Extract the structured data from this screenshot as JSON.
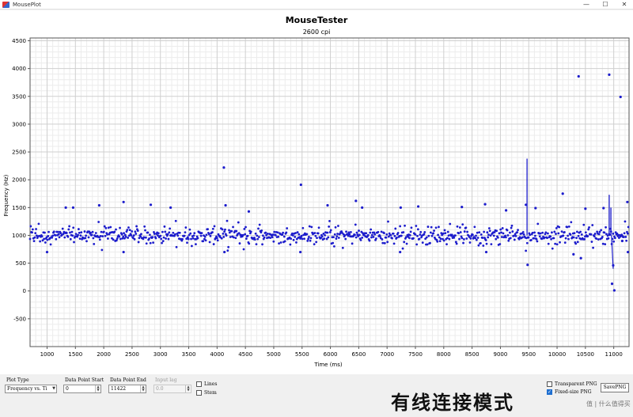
{
  "window": {
    "title": "MousePlot",
    "min_glyph": "—",
    "max_glyph": "☐",
    "close_glyph": "✕"
  },
  "chart_data": {
    "type": "scatter",
    "title": "MouseTester",
    "subtitle": "2600 cpi",
    "xlabel": "Time (ms)",
    "ylabel": "Frequency (Hz)",
    "xlim": [
      700,
      11270
    ],
    "ylim": [
      -1000,
      4550
    ],
    "xticks": [
      1000,
      1500,
      2000,
      2500,
      3000,
      3500,
      4000,
      4500,
      5000,
      5500,
      6000,
      6500,
      7000,
      7500,
      8000,
      8500,
      9000,
      9500,
      10000,
      10500,
      11000
    ],
    "yticks": [
      -500,
      0,
      500,
      1000,
      1500,
      2000,
      2500,
      3000,
      3500,
      4000,
      4500
    ],
    "grid": true,
    "marker_color": "#1c1ccc",
    "baseline_hz": 1000,
    "outliers": [
      {
        "x": 4120,
        "y": 2220
      },
      {
        "x": 5480,
        "y": 1910
      },
      {
        "x": 10380,
        "y": 3860
      },
      {
        "x": 10920,
        "y": 3890
      },
      {
        "x": 11120,
        "y": 3490
      },
      {
        "x": 10100,
        "y": 1750
      },
      {
        "x": 10970,
        "y": 130
      },
      {
        "x": 11010,
        "y": 10
      },
      {
        "x": 10990,
        "y": 460
      },
      {
        "x": 9480,
        "y": 470
      },
      {
        "x": 10420,
        "y": 590
      },
      {
        "x": 11150,
        "y": 900
      },
      {
        "x": 2350,
        "y": 1600
      },
      {
        "x": 2830,
        "y": 1550
      },
      {
        "x": 6450,
        "y": 1620
      },
      {
        "x": 8730,
        "y": 1560
      },
      {
        "x": 9450,
        "y": 1550
      },
      {
        "x": 11240,
        "y": 1600
      },
      {
        "x": 1330,
        "y": 1500
      },
      {
        "x": 1460,
        "y": 1500
      },
      {
        "x": 1920,
        "y": 1540
      },
      {
        "x": 3180,
        "y": 1500
      },
      {
        "x": 4150,
        "y": 1540
      },
      {
        "x": 4560,
        "y": 1430
      },
      {
        "x": 5950,
        "y": 1540
      },
      {
        "x": 6560,
        "y": 1500
      },
      {
        "x": 7240,
        "y": 1500
      },
      {
        "x": 7550,
        "y": 1520
      },
      {
        "x": 8320,
        "y": 1510
      },
      {
        "x": 9100,
        "y": 1450
      },
      {
        "x": 9620,
        "y": 1490
      },
      {
        "x": 10500,
        "y": 1480
      },
      {
        "x": 10820,
        "y": 1490
      },
      {
        "x": 1000,
        "y": 700
      },
      {
        "x": 2350,
        "y": 700
      },
      {
        "x": 4130,
        "y": 700
      },
      {
        "x": 5470,
        "y": 700
      },
      {
        "x": 7230,
        "y": 700
      },
      {
        "x": 8750,
        "y": 700
      },
      {
        "x": 10290,
        "y": 660
      },
      {
        "x": 11250,
        "y": 700
      }
    ],
    "spikes": [
      {
        "x": 9470,
        "y": 2380
      },
      {
        "x": 10920,
        "y": 1730
      },
      {
        "x": 10950,
        "y": 1500
      }
    ]
  },
  "controls": {
    "plot_type_label": "Plot Type",
    "plot_type_value": "Frequency vs. Ti",
    "start_label": "Data Point Start",
    "start_value": "0",
    "end_label": "Data Point End",
    "end_value": "11422",
    "input_lag_label": "Input lag",
    "input_lag_value": "0.0",
    "lines_label": "Lines",
    "stem_label": "Stem",
    "transparent_label": "Transparent PNG",
    "fixed_label": "Fixed-size PNG",
    "save_label": "SavePNG",
    "spin_up": "▲",
    "spin_down": "▼",
    "dropdown_arrow": "▼",
    "check_mark": "✓"
  },
  "overlay": {
    "watermark": "有线连接模式",
    "badge": "值 | 什么值得买"
  }
}
